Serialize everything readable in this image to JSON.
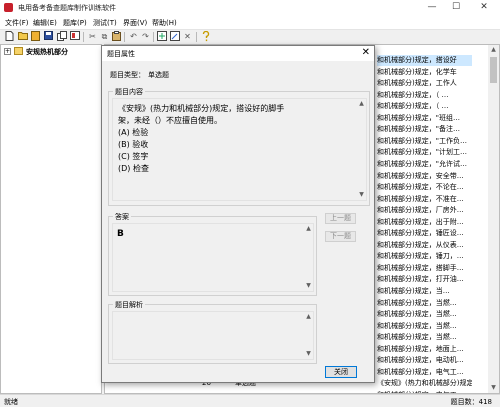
{
  "window": {
    "title": "电用备考备查题库制作训练软件",
    "minimize": "—",
    "maximize": "☐",
    "close": "✕"
  },
  "menu": [
    {
      "label": "文件(F)"
    },
    {
      "label": "编辑(E)"
    },
    {
      "label": "题库(P)"
    },
    {
      "label": "测试(T)"
    },
    {
      "label": "界面(V)"
    },
    {
      "label": "帮助(H)"
    }
  ],
  "tree": {
    "expander": "+",
    "root_label": "安规热机部分"
  },
  "list_rows": [
    {
      "num": "",
      "type": "",
      "content": "和机械部分)规定，搭设好",
      "selected": true
    },
    {
      "num": "",
      "type": "",
      "content": "和机械部分)规定，化学车",
      "selected": false
    },
    {
      "num": "",
      "type": "",
      "content": "和机械部分)规定，工作人",
      "selected": false
    },
    {
      "num": "",
      "type": "",
      "content": "和机械部分)规定，（    …",
      "selected": false
    },
    {
      "num": "",
      "type": "",
      "content": "和机械部分)规定，（    …",
      "selected": false
    },
    {
      "num": "",
      "type": "",
      "content": "和机械部分)规定，\"班组…",
      "selected": false
    },
    {
      "num": "",
      "type": "",
      "content": "和机械部分)规定，\"备注…",
      "selected": false
    },
    {
      "num": "",
      "type": "",
      "content": "和机械部分)规定，\"工作负…",
      "selected": false
    },
    {
      "num": "",
      "type": "",
      "content": "和机械部分)规定，\"计划工…",
      "selected": false
    },
    {
      "num": "",
      "type": "",
      "content": "和机械部分)规定，\"允许试…",
      "selected": false
    },
    {
      "num": "",
      "type": "",
      "content": "和机械部分)规定，安全带…",
      "selected": false
    },
    {
      "num": "",
      "type": "",
      "content": "和机械部分)规定，不论在…",
      "selected": false
    },
    {
      "num": "",
      "type": "",
      "content": "和机械部分)规定，不准在…",
      "selected": false
    },
    {
      "num": "",
      "type": "",
      "content": "和机械部分)规定，厂房外…",
      "selected": false
    },
    {
      "num": "",
      "type": "",
      "content": "和机械部分)规定，出于附…",
      "selected": false
    },
    {
      "num": "",
      "type": "",
      "content": "和机械部分)规定，锤匠设…",
      "selected": false
    },
    {
      "num": "",
      "type": "",
      "content": "和机械部分)规定，从仪表…",
      "selected": false
    },
    {
      "num": "",
      "type": "",
      "content": "和机械部分)规定，锤刀，…",
      "selected": false
    },
    {
      "num": "",
      "type": "",
      "content": "和机械部分)规定，搭脚手…",
      "selected": false
    },
    {
      "num": "",
      "type": "",
      "content": "和机械部分)规定，打开油…",
      "selected": false
    },
    {
      "num": "",
      "type": "",
      "content": "和机械部分)规定，当…",
      "selected": false
    },
    {
      "num": "",
      "type": "",
      "content": "和机械部分)规定，当燃…",
      "selected": false
    },
    {
      "num": "",
      "type": "",
      "content": "和机械部分)规定，当燃…",
      "selected": false
    },
    {
      "num": "",
      "type": "",
      "content": "和机械部分)规定，当燃…",
      "selected": false
    },
    {
      "num": "",
      "type": "",
      "content": "和机械部分)规定，当燃…",
      "selected": false
    },
    {
      "num": "",
      "type": "",
      "content": "和机械部分)规定，地面上…",
      "selected": false
    },
    {
      "num": "",
      "type": "",
      "content": "和机械部分)规定，电动机…",
      "selected": false
    },
    {
      "num": "",
      "type": "",
      "content": "和机械部分)规定，电气工…",
      "selected": false
    },
    {
      "num": "26",
      "type": "单选题",
      "content": "《安规》(热力和机械部分)规定，电气工…",
      "selected": false
    },
    {
      "num": "",
      "type": "",
      "content": "和机械部分)规定，电气工…",
      "selected": false
    }
  ],
  "status": {
    "left": "就绪",
    "right": "题目数：418"
  },
  "dialog": {
    "title": "题目属性",
    "close": "✕",
    "type_label": "题目类型：",
    "type_value": "单选题",
    "content_legend": "题目内容",
    "question": "《安规》(热力和机械部分)规定，搭设好的脚手架，未经（）不应擅自使用。",
    "options": [
      "(A) 检验",
      "(B) 验收",
      "(C) 签字",
      "(D) 检查"
    ],
    "answer_legend": "答案",
    "answer": "B",
    "explain_legend": "题目解析",
    "prev_button": "上一题",
    "next_button": "下一题",
    "close_button": "关闭"
  }
}
